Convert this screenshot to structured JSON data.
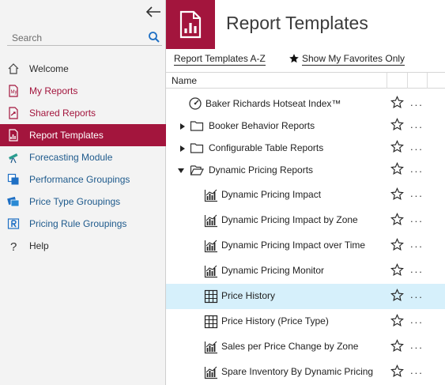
{
  "sidebar": {
    "search_placeholder": "Search",
    "items": [
      {
        "label": "Welcome",
        "icon": "home-icon"
      },
      {
        "label": "My Reports",
        "icon": "my-reports-icon"
      },
      {
        "label": "Shared Reports",
        "icon": "shared-reports-icon"
      },
      {
        "label": "Report Templates",
        "icon": "report-templates-icon",
        "active": true
      },
      {
        "label": "Forecasting Module",
        "icon": "telescope-icon"
      },
      {
        "label": "Performance Groupings",
        "icon": "performance-groupings-icon"
      },
      {
        "label": "Price Type Groupings",
        "icon": "price-type-groupings-icon"
      },
      {
        "label": "Pricing Rule Groupings",
        "icon": "pricing-rule-groupings-icon"
      },
      {
        "label": "Help",
        "icon": "help-icon"
      }
    ]
  },
  "header": {
    "title": "Report Templates"
  },
  "tabs": {
    "az_label": "Report Templates A-Z",
    "favorites_label": "Show My Favorites Only"
  },
  "table": {
    "column_name": "Name",
    "more_label": "...",
    "rows": [
      {
        "label": "Baker Richards Hotseat Index™",
        "icon": "gauge-icon",
        "level": 0
      },
      {
        "label": "Booker Behavior Reports",
        "icon": "folder-icon",
        "level": 0,
        "expander": "collapsed"
      },
      {
        "label": "Configurable Table Reports",
        "icon": "folder-icon",
        "level": 0,
        "expander": "collapsed"
      },
      {
        "label": "Dynamic Pricing Reports",
        "icon": "folder-open-icon",
        "level": 0,
        "expander": "expanded"
      },
      {
        "label": "Dynamic Pricing Impact",
        "icon": "chart-icon",
        "level": 1
      },
      {
        "label": "Dynamic Pricing Impact by Zone",
        "icon": "chart-icon",
        "level": 1
      },
      {
        "label": "Dynamic Pricing Impact over Time",
        "icon": "chart-icon",
        "level": 1
      },
      {
        "label": "Dynamic Pricing Monitor",
        "icon": "chart-icon",
        "level": 1
      },
      {
        "label": "Price History",
        "icon": "table-icon",
        "level": 1,
        "selected": true
      },
      {
        "label": "Price History (Price Type)",
        "icon": "table-icon",
        "level": 1
      },
      {
        "label": "Sales per Price Change by Zone",
        "icon": "chart-icon",
        "level": 1
      },
      {
        "label": "Spare Inventory By Dynamic Pricing",
        "icon": "chart-icon",
        "level": 1
      }
    ]
  },
  "colors": {
    "brand": "#a3153d",
    "selected_row": "#d6f0fb",
    "sidebar_bg": "#f3f3f3",
    "link_blue": "#1e5a8c"
  }
}
